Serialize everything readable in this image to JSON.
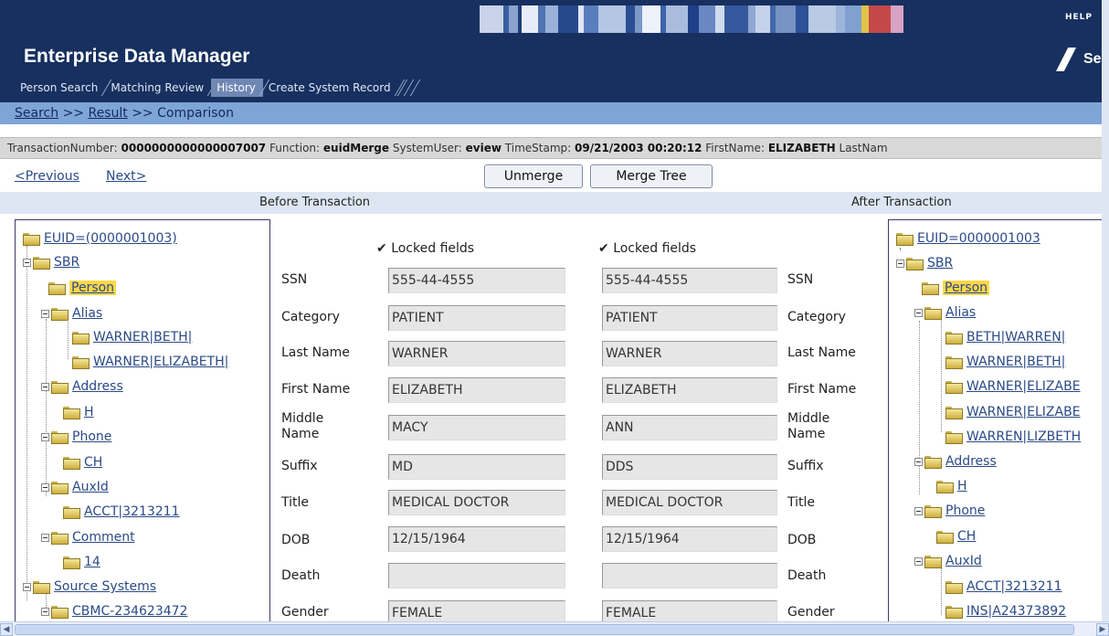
{
  "header": {
    "app_title": "Enterprise Data Manager",
    "help_label": "HELP",
    "logo_text": "Se",
    "tabs": [
      {
        "label": "Person Search"
      },
      {
        "label": "Matching Review"
      },
      {
        "label": "History"
      },
      {
        "label": "Create System Record"
      }
    ],
    "active_tab": "History"
  },
  "breadcrumb": {
    "search": "Search",
    "sep1": ">>",
    "result": "Result",
    "sep2": ">>",
    "comparison": "Comparison"
  },
  "transaction": {
    "number_label": "TransactionNumber:",
    "number_value": "0000000000000007007",
    "function_label": "Function:",
    "function_value": "euidMerge",
    "user_label": "SystemUser:",
    "user_value": "eview",
    "timestamp_label": "TimeStamp:",
    "timestamp_value": "09/21/2003 00:20:12",
    "firstname_label": "FirstName:",
    "firstname_value": "ELIZABETH",
    "lastname_label": "LastNam"
  },
  "nav": {
    "previous": "<Previous",
    "next": "Next>",
    "unmerge": "Unmerge",
    "merge_tree": "Merge Tree"
  },
  "sections": {
    "before": "Before Transaction",
    "after": "After Transaction"
  },
  "left_tree": [
    {
      "label": "EUID=(0000001003)"
    },
    {
      "label": "SBR"
    },
    {
      "label": "Person"
    },
    {
      "label": "Alias"
    },
    {
      "label": "WARNER|BETH|"
    },
    {
      "label": "WARNER|ELIZABETH|"
    },
    {
      "label": "Address"
    },
    {
      "label": "H"
    },
    {
      "label": "Phone"
    },
    {
      "label": "CH"
    },
    {
      "label": "AuxId"
    },
    {
      "label": "ACCT|3213211"
    },
    {
      "label": "Comment"
    },
    {
      "label": "14"
    },
    {
      "label": "Source Systems"
    },
    {
      "label": "CBMC-234623472"
    }
  ],
  "right_tree": [
    {
      "label": "EUID=0000001003"
    },
    {
      "label": "SBR"
    },
    {
      "label": "Person"
    },
    {
      "label": "Alias"
    },
    {
      "label": "BETH|WARREN|"
    },
    {
      "label": "WARNER|BETH|"
    },
    {
      "label": "WARNER|ELIZABE"
    },
    {
      "label": "WARNER|ELIZABE"
    },
    {
      "label": "WARREN|LIZBETH"
    },
    {
      "label": "Address"
    },
    {
      "label": "H"
    },
    {
      "label": "Phone"
    },
    {
      "label": "CH"
    },
    {
      "label": "AuxId"
    },
    {
      "label": "ACCT|3213211"
    },
    {
      "label": "INS|A24373892"
    }
  ],
  "locked_fields_label": "Locked fields",
  "fields": [
    {
      "label": "SSN",
      "before": "555-44-4555",
      "after": "555-44-4555"
    },
    {
      "label": "Category",
      "before": "PATIENT",
      "after": "PATIENT"
    },
    {
      "label": "Last Name",
      "before": "WARNER",
      "after": "WARNER"
    },
    {
      "label": "First Name",
      "before": "ELIZABETH",
      "after": "ELIZABETH"
    },
    {
      "label": "Middle Name",
      "before": "MACY",
      "after": "ANN"
    },
    {
      "label": "Suffix",
      "before": "MD",
      "after": "DDS"
    },
    {
      "label": "Title",
      "before": "MEDICAL DOCTOR",
      "after": "MEDICAL DOCTOR"
    },
    {
      "label": "DOB",
      "before": "12/15/1964",
      "after": "12/15/1964"
    },
    {
      "label": "Death",
      "before": "",
      "after": ""
    },
    {
      "label": "Gender",
      "before": "FEMALE",
      "after": "FEMALE"
    }
  ],
  "colors": {
    "header_bg": "#17305f",
    "breadcrumb_bg": "#7fa4d6",
    "selected_node": "#ffd74a",
    "link": "#2a4a86"
  }
}
